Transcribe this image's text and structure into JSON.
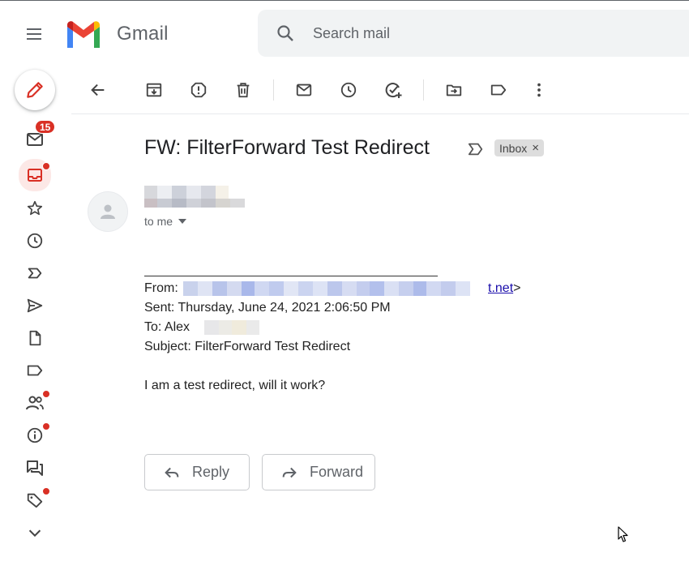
{
  "app": {
    "name": "Gmail"
  },
  "search": {
    "placeholder": "Search mail"
  },
  "rail": {
    "unread_badge": "15"
  },
  "message": {
    "subject": "FW: FilterForward Test Redirect",
    "label_chip": "Inbox",
    "label_close": "×",
    "recipient_line": "to me",
    "forward_header": {
      "from_label": "From:",
      "from_link": "t.net",
      "from_suffix": ">",
      "sent": "Sent: Thursday, June 24, 2021 2:06:50 PM",
      "to": "To: Alex",
      "subject": "Subject: FilterForward Test Redirect"
    },
    "body": "I am a test redirect, will it work?"
  },
  "actions": {
    "reply_label": "Reply",
    "forward_label": "Forward"
  },
  "colors": {
    "accent_red": "#d93025",
    "link_blue": "#1a0dab",
    "search_bg": "#f1f3f4",
    "icon_gray": "#5f6368",
    "active_bg": "#fce8e6"
  }
}
